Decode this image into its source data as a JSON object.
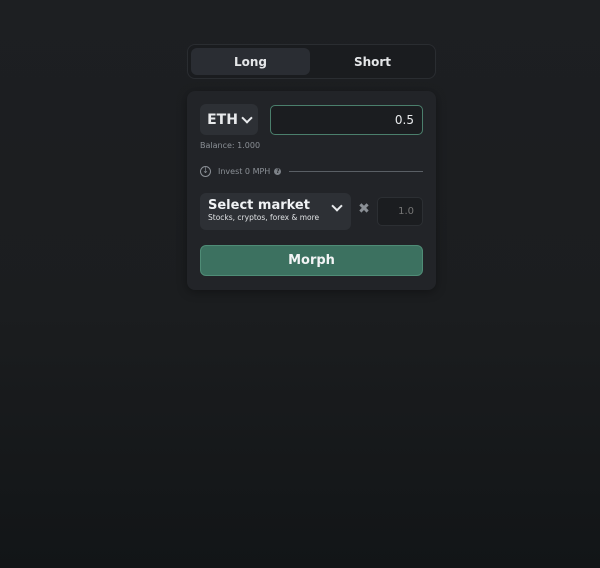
{
  "tabs": [
    {
      "label": "Long",
      "active": true
    },
    {
      "label": "Short",
      "active": false
    }
  ],
  "trade": {
    "asset": "ETH",
    "amount_value": "0.5",
    "balance": "Balance: 1.000",
    "invest_label": "Invest 0 MPH",
    "help_glyph": "?",
    "market": {
      "title": "Select market",
      "subtitle": "Stocks, cryptos, forex & more"
    },
    "times_glyph": "✖",
    "leverage_placeholder": "1.0",
    "action_label": "Morph"
  },
  "colors": {
    "accent": "#3c7160",
    "accent_border": "#4b7f6c",
    "background": "#1d1f22",
    "card": "#222428"
  },
  "icons": [
    "chevron-down-icon",
    "download-circle-icon",
    "help-icon",
    "times-icon"
  ]
}
